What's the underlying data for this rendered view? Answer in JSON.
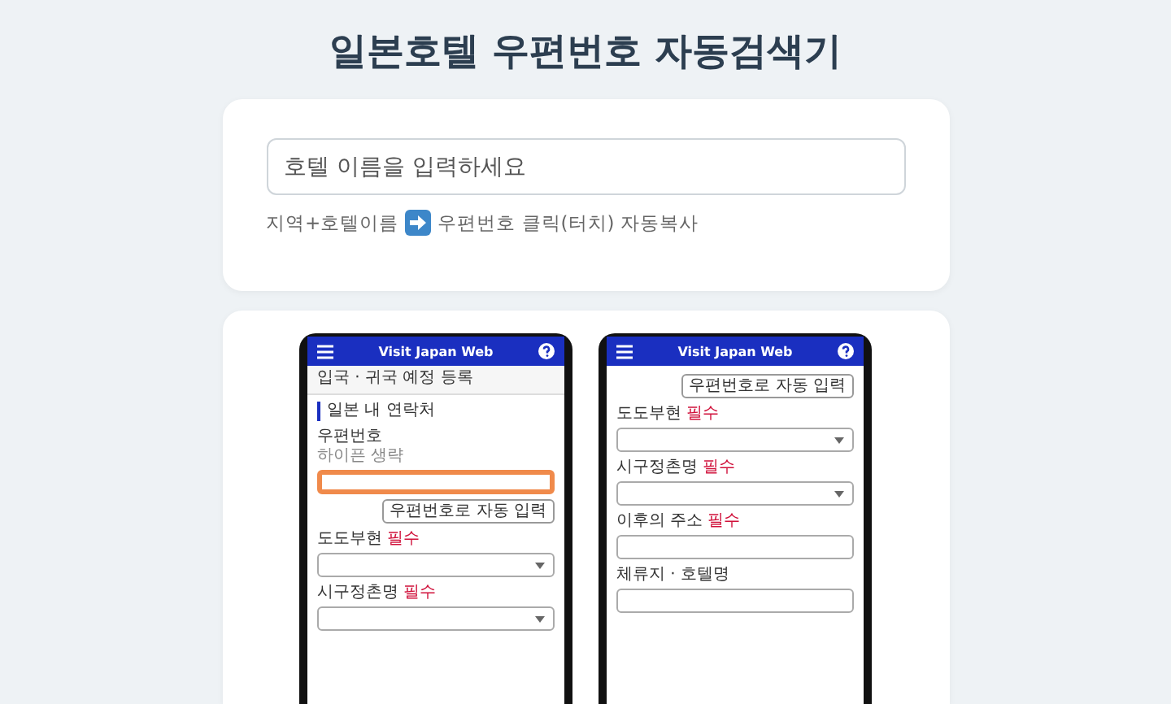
{
  "title": "일본호텔 우편번호 자동검색기",
  "search": {
    "placeholder": "호텔 이름을 입력하세요"
  },
  "hint": {
    "before": "지역+호텔이름",
    "after": "우편번호 클릭(터치) 자동복사"
  },
  "phones": [
    {
      "app_title": "Visit Japan Web",
      "items": [
        {
          "kind": "page-title",
          "text": "입국 · 귀국 예정 등록"
        },
        {
          "kind": "section",
          "text": "일본 내 연락처"
        },
        {
          "kind": "label",
          "text": "우편번호"
        },
        {
          "kind": "hint",
          "text": "하이픈 생략"
        },
        {
          "kind": "input",
          "highlighted": true
        },
        {
          "kind": "button",
          "text": "우편번호로 자동 입력"
        },
        {
          "kind": "label",
          "text": "도도부현",
          "required": "필수"
        },
        {
          "kind": "select"
        },
        {
          "kind": "label",
          "text": "시구정촌명",
          "required": "필수"
        },
        {
          "kind": "select"
        }
      ]
    },
    {
      "app_title": "Visit Japan Web",
      "items": [
        {
          "kind": "button",
          "text": "우편번호로 자동 입력"
        },
        {
          "kind": "label",
          "text": "도도부현",
          "required": "필수"
        },
        {
          "kind": "select"
        },
        {
          "kind": "label",
          "text": "시구정촌명",
          "required": "필수"
        },
        {
          "kind": "select"
        },
        {
          "kind": "label",
          "text": "이후의 주소",
          "required": "필수"
        },
        {
          "kind": "input",
          "highlighted": false
        },
        {
          "kind": "label",
          "text": "체류지 · 호텔명"
        },
        {
          "kind": "input",
          "highlighted": false
        }
      ]
    }
  ]
}
